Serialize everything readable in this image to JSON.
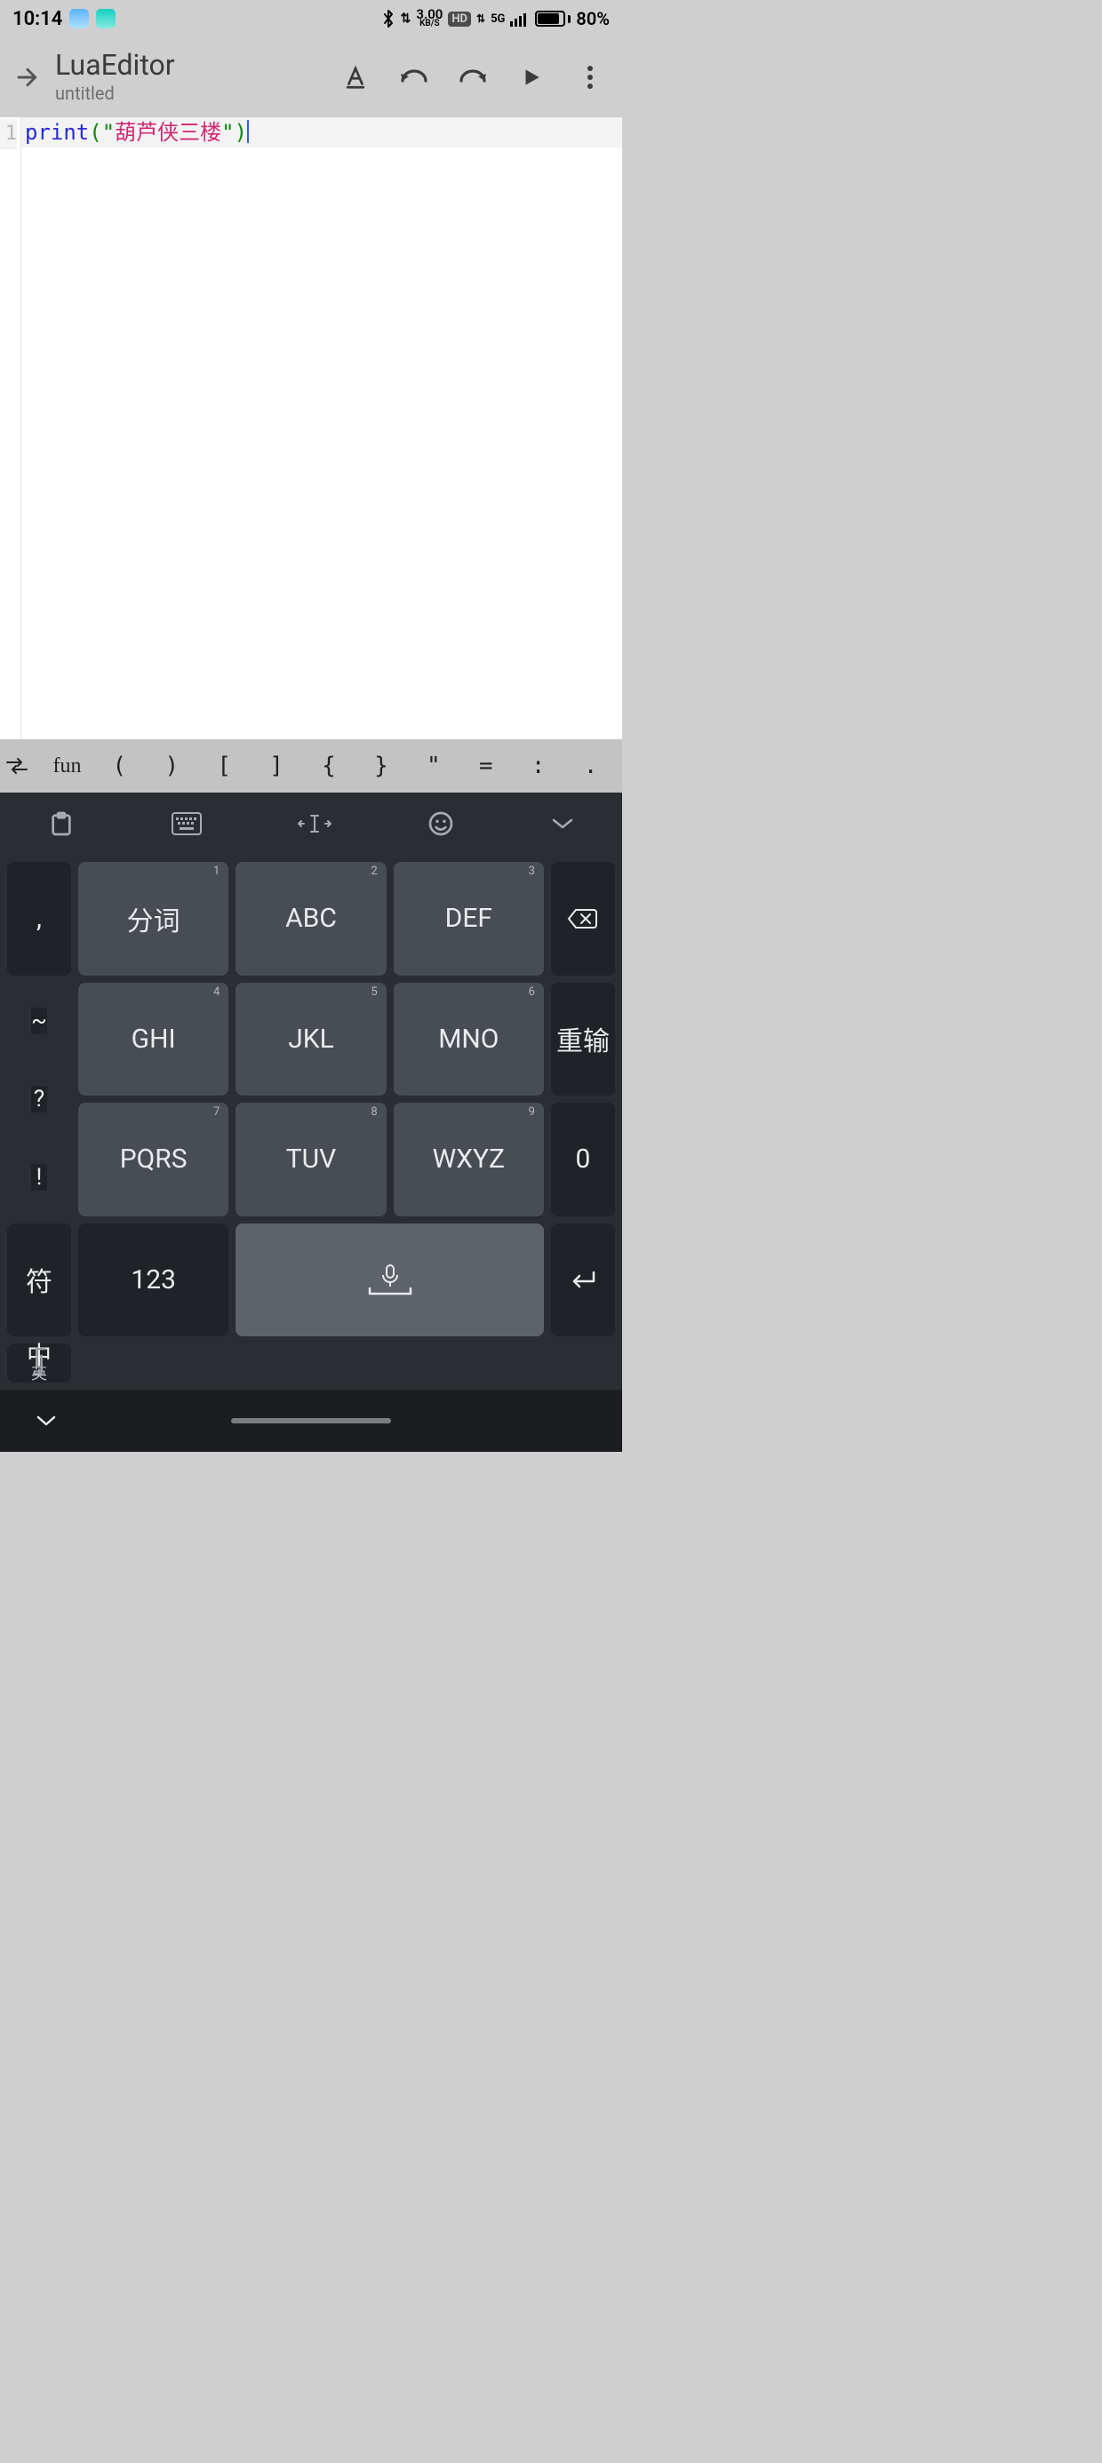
{
  "status": {
    "time": "10:14",
    "net_rate": "3.00",
    "net_unit": "KB/S",
    "hd": "HD",
    "net_gen": "5G",
    "battery_pct": "80%"
  },
  "appbar": {
    "title": "LuaEditor",
    "subtitle": "untitled"
  },
  "editor": {
    "line_no": "1",
    "tok_func": "print",
    "tok_lparen": "(",
    "tok_q1": "\"",
    "tok_string": "葫芦侠三楼",
    "tok_q2": "\"",
    "tok_rparen": ")"
  },
  "symbols": {
    "fun": "fun",
    "lparen": "(",
    "rparen": ")",
    "lbrack": "[",
    "rbrack": "]",
    "lbrace": "{",
    "rbrace": "}",
    "dquote": "\"",
    "equals": "=",
    "colon": ":",
    "dot": "."
  },
  "keys": {
    "comma": ",",
    "tilde": "~",
    "qmark": "?",
    "excl": "!",
    "fenci": "分词",
    "abc": "ABC",
    "def": "DEF",
    "ghi": "GHI",
    "jkl": "JKL",
    "mno": "MNO",
    "pqrs": "PQRS",
    "tuv": "TUV",
    "wxyz": "WXYZ",
    "reinput": "重输",
    "zero": "0",
    "sym": "符",
    "num": "123",
    "lang_top": "中",
    "lang_bot": "英",
    "n1": "1",
    "n2": "2",
    "n3": "3",
    "n4": "4",
    "n5": "5",
    "n6": "6",
    "n7": "7",
    "n8": "8",
    "n9": "9"
  }
}
